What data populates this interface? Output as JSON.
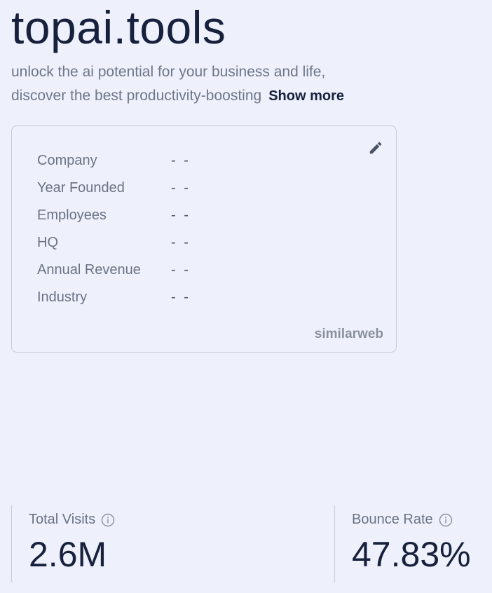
{
  "header": {
    "title": "topai.tools",
    "description_line1": "unlock the ai potential for your business and life,",
    "description_line2": "discover the best productivity-boosting",
    "show_more": "Show more"
  },
  "company_card": {
    "rows": [
      {
        "label": "Company",
        "value": "- -"
      },
      {
        "label": "Year Founded",
        "value": "- -"
      },
      {
        "label": "Employees",
        "value": "- -"
      },
      {
        "label": "HQ",
        "value": "- -"
      },
      {
        "label": "Annual Revenue",
        "value": "- -"
      },
      {
        "label": "Industry",
        "value": "- -"
      }
    ],
    "edit_icon": "pencil-icon",
    "brand": "similarweb"
  },
  "stats": {
    "total_visits": {
      "label": "Total Visits",
      "value": "2.6M",
      "icon": "info-icon"
    },
    "bounce_rate": {
      "label": "Bounce Rate",
      "value": "47.83%",
      "icon": "info-icon"
    }
  },
  "colors": {
    "background": "#eef1fb",
    "text_dark": "#17213d",
    "text_muted": "#6b7283",
    "border": "#c6cbd8",
    "brand_accent": "#e8956d"
  }
}
